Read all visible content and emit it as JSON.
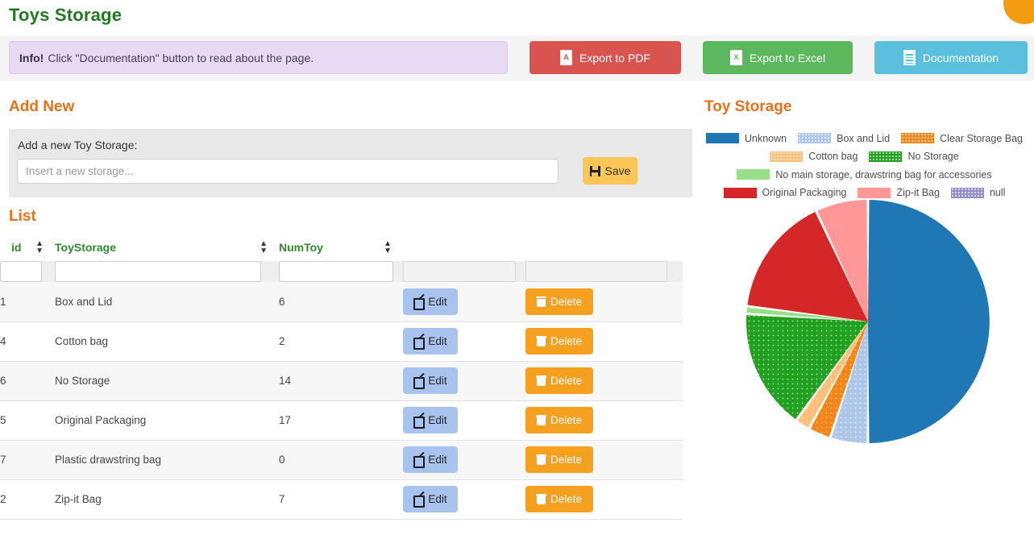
{
  "page": {
    "title": "Toys Storage"
  },
  "alert": {
    "strong": "Info!",
    "text": "Click \"Documentation\" button to read about the page."
  },
  "toolbar": {
    "pdf_label": "Export to PDF",
    "excel_label": "Export to Excel",
    "doc_label": "Documentation",
    "pdf_glyph": "A",
    "excel_glyph": "X",
    "pdf_color": "#d9534f",
    "excel_color": "#5cb85c",
    "doc_color": "#5bc0de"
  },
  "add_new": {
    "heading": "Add New",
    "field_label": "Add a new Toy Storage:",
    "input_value": "",
    "input_placeholder": "Insert a new storage...",
    "save_label": "Save",
    "save_color": "#fcc657"
  },
  "list": {
    "heading": "List",
    "columns": [
      "id",
      "ToyStorage",
      "NumToy",
      "",
      ""
    ],
    "filters": [
      "",
      "",
      "",
      "",
      ""
    ],
    "edit_label": "Edit",
    "delete_label": "Delete",
    "edit_color": "#a8c4ee",
    "delete_color": "#f5a01e",
    "rows": [
      {
        "id": "1",
        "storage": "Box and Lid",
        "num": "6"
      },
      {
        "id": "4",
        "storage": "Cotton bag",
        "num": "2"
      },
      {
        "id": "6",
        "storage": "No Storage",
        "num": "14"
      },
      {
        "id": "5",
        "storage": "Original Packaging",
        "num": "17"
      },
      {
        "id": "7",
        "storage": "Plastic drawstring bag",
        "num": "0"
      },
      {
        "id": "2",
        "storage": "Zip-it Bag",
        "num": "7"
      }
    ]
  },
  "chart_data": {
    "type": "pie",
    "title": "Toy Storage",
    "legend_position": "top",
    "start_angle_deg": 0,
    "direction": "clockwise",
    "labels": [
      "Unknown",
      "Box and Lid",
      "Clear Storage Bag",
      "Cotton bag",
      "No Storage",
      "No main storage, drawstring bag for accessories",
      "Original Packaging",
      "Zip-it Bag",
      "null"
    ],
    "values": [
      50,
      5,
      3,
      2,
      16,
      1,
      16,
      7,
      0
    ],
    "colors": [
      "#1f77b4",
      "#aec7e8",
      "#f58518",
      "#ffbf79",
      "#23a021",
      "#98df8a",
      "#d62728",
      "#ff9896",
      "#9590c4"
    ],
    "patterned": [
      false,
      true,
      true,
      true,
      true,
      false,
      false,
      false,
      true
    ]
  }
}
